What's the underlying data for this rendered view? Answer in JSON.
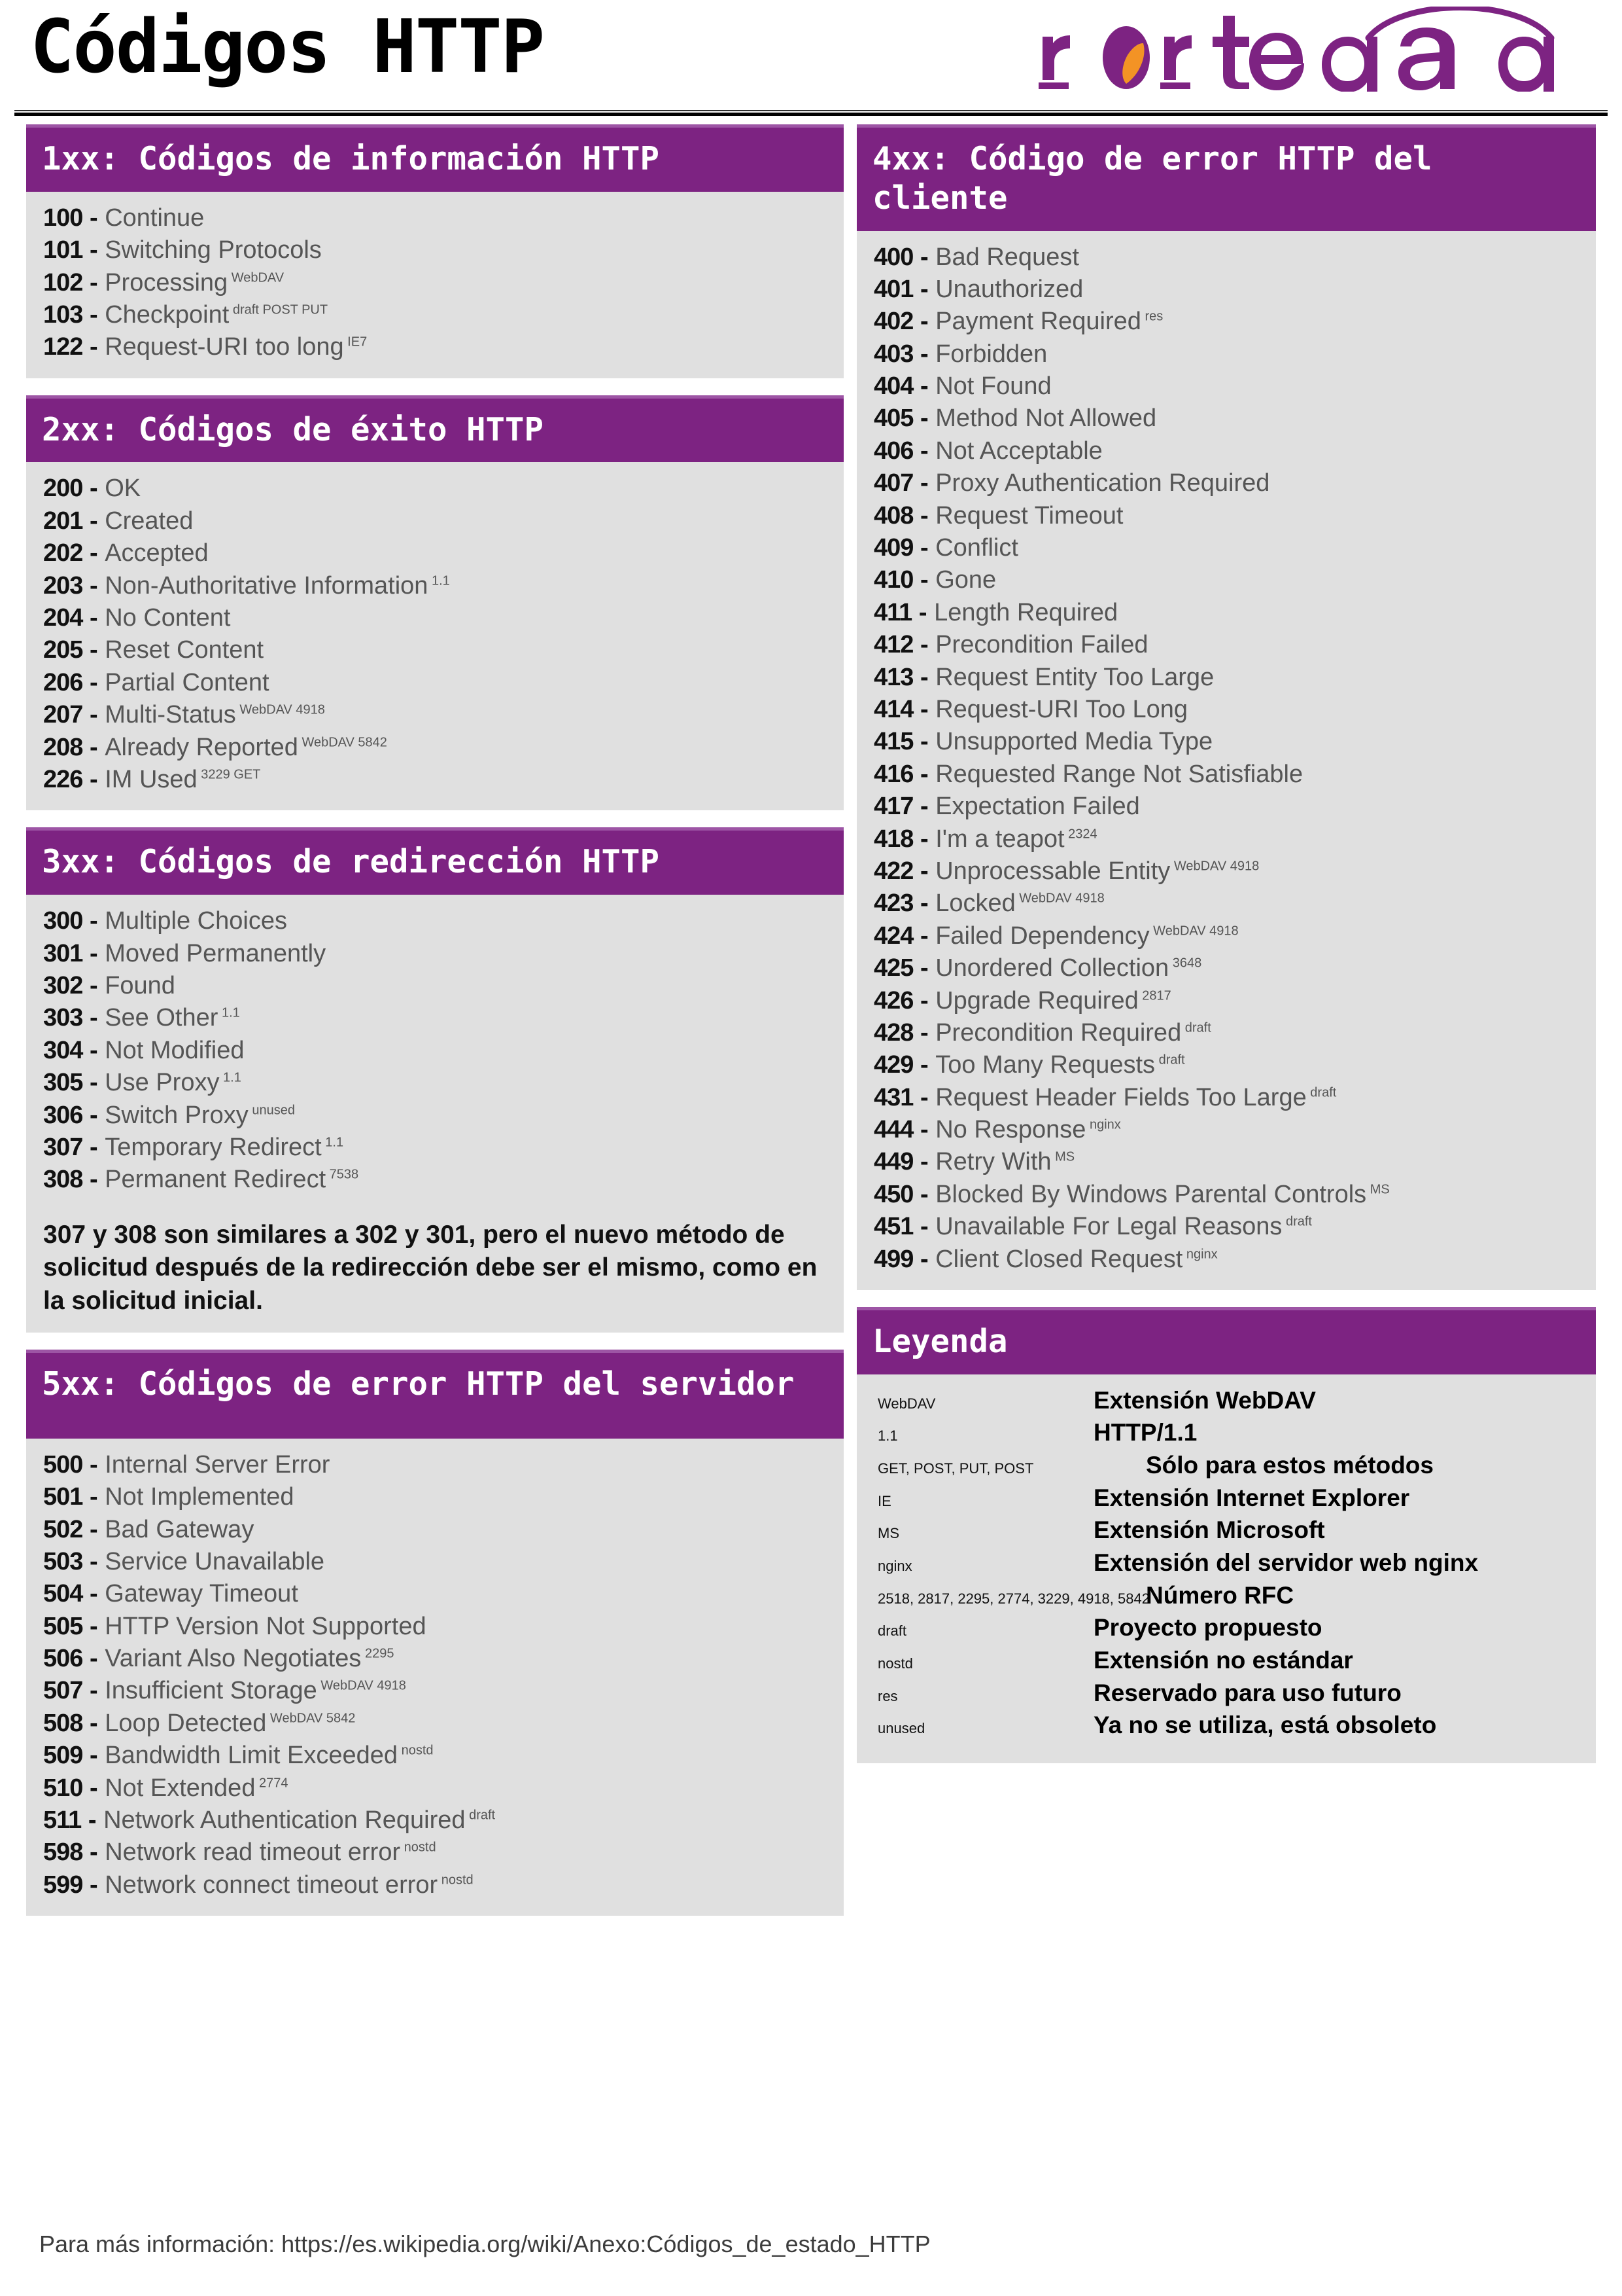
{
  "header": {
    "title": "Códigos HTTP",
    "brand": "rortegag",
    "brand_colors": {
      "purple": "#7D2382",
      "orange": "#F39325"
    }
  },
  "theme": {
    "header_purple": "#7D2382",
    "panel_gray": "#e0e0e0",
    "code_text": "#555555"
  },
  "panels": {
    "informational": {
      "heading": "1xx: Códigos de información HTTP",
      "codes": [
        {
          "num": "100",
          "text": "Continue",
          "sup": ""
        },
        {
          "num": "101",
          "text": "Switching Protocols",
          "sup": ""
        },
        {
          "num": "102",
          "text": "Processing",
          "sup": "WebDAV"
        },
        {
          "num": "103",
          "text": "Checkpoint",
          "sup": "draft POST PUT"
        },
        {
          "num": "122",
          "text": "Request-URI too long",
          "sup": "IE7"
        }
      ]
    },
    "success": {
      "heading": "2xx: Códigos de éxito HTTP",
      "codes": [
        {
          "num": "200",
          "text": "OK",
          "sup": ""
        },
        {
          "num": "201",
          "text": "Created",
          "sup": ""
        },
        {
          "num": "202",
          "text": "Accepted",
          "sup": ""
        },
        {
          "num": "203",
          "text": "Non-Authoritative Information",
          "sup": "1.1"
        },
        {
          "num": "204",
          "text": "No Content",
          "sup": ""
        },
        {
          "num": "205",
          "text": "Reset Content",
          "sup": ""
        },
        {
          "num": "206",
          "text": "Partial Content",
          "sup": ""
        },
        {
          "num": "207",
          "text": "Multi-Status",
          "sup": "WebDAV 4918"
        },
        {
          "num": "208",
          "text": "Already Reported",
          "sup": "WebDAV 5842"
        },
        {
          "num": "226",
          "text": "IM Used",
          "sup": "3229 GET"
        }
      ]
    },
    "redirection": {
      "heading": "3xx: Códigos de redirección HTTP",
      "codes": [
        {
          "num": "300",
          "text": "Multiple Choices",
          "sup": ""
        },
        {
          "num": "301",
          "text": "Moved Permanently",
          "sup": ""
        },
        {
          "num": "302",
          "text": "Found",
          "sup": ""
        },
        {
          "num": "303",
          "text": "See Other",
          "sup": "1.1"
        },
        {
          "num": "304",
          "text": "Not Modified",
          "sup": ""
        },
        {
          "num": "305",
          "text": "Use Proxy",
          "sup": "1.1"
        },
        {
          "num": "306",
          "text": "Switch Proxy",
          "sup": "unused"
        },
        {
          "num": "307",
          "text": "Temporary Redirect",
          "sup": "1.1"
        },
        {
          "num": "308",
          "text": "Permanent Redirect",
          "sup": "7538"
        }
      ],
      "note": "307 y 308 son similares a 302 y 301, pero el nuevo método de solicitud después de la redirección debe ser el mismo, como en la solicitud inicial."
    },
    "server_error": {
      "heading": "5xx: Códigos de error HTTP del servidor",
      "codes": [
        {
          "num": "500",
          "text": "Internal Server Error",
          "sup": ""
        },
        {
          "num": "501",
          "text": "Not Implemented",
          "sup": ""
        },
        {
          "num": "502",
          "text": "Bad Gateway",
          "sup": ""
        },
        {
          "num": "503",
          "text": "Service Unavailable",
          "sup": ""
        },
        {
          "num": "504",
          "text": "Gateway Timeout",
          "sup": ""
        },
        {
          "num": "505",
          "text": "HTTP Version Not Supported",
          "sup": ""
        },
        {
          "num": "506",
          "text": "Variant Also Negotiates",
          "sup": "2295"
        },
        {
          "num": "507",
          "text": "Insufficient Storage",
          "sup": "WebDAV 4918"
        },
        {
          "num": "508",
          "text": "Loop Detected",
          "sup": "WebDAV 5842"
        },
        {
          "num": "509",
          "text": "Bandwidth Limit Exceeded",
          "sup": "nostd"
        },
        {
          "num": "510",
          "text": "Not Extended",
          "sup": "2774"
        },
        {
          "num": "511",
          "text": "Network Authentication Required",
          "sup": "draft"
        },
        {
          "num": "598",
          "text": "Network read timeout error",
          "sup": "nostd"
        },
        {
          "num": "599",
          "text": "Network connect timeout error",
          "sup": "nostd"
        }
      ]
    },
    "client_error": {
      "heading": "4xx: Código de error HTTP del cliente",
      "codes": [
        {
          "num": "400",
          "text": "Bad Request",
          "sup": ""
        },
        {
          "num": "401",
          "text": "Unauthorized",
          "sup": ""
        },
        {
          "num": "402",
          "text": "Payment Required",
          "sup": "res"
        },
        {
          "num": "403",
          "text": "Forbidden",
          "sup": ""
        },
        {
          "num": "404",
          "text": "Not Found",
          "sup": ""
        },
        {
          "num": "405",
          "text": "Method Not Allowed",
          "sup": ""
        },
        {
          "num": "406",
          "text": "Not Acceptable",
          "sup": ""
        },
        {
          "num": "407",
          "text": "Proxy Authentication Required",
          "sup": ""
        },
        {
          "num": "408",
          "text": "Request Timeout",
          "sup": ""
        },
        {
          "num": "409",
          "text": "Conflict",
          "sup": ""
        },
        {
          "num": "410",
          "text": "Gone",
          "sup": ""
        },
        {
          "num": "411",
          "text": "Length Required",
          "sup": ""
        },
        {
          "num": "412",
          "text": "Precondition Failed",
          "sup": ""
        },
        {
          "num": "413",
          "text": "Request Entity Too Large",
          "sup": ""
        },
        {
          "num": "414",
          "text": "Request-URI Too Long",
          "sup": ""
        },
        {
          "num": "415",
          "text": "Unsupported Media Type",
          "sup": ""
        },
        {
          "num": "416",
          "text": "Requested Range Not Satisfiable",
          "sup": ""
        },
        {
          "num": "417",
          "text": "Expectation Failed",
          "sup": ""
        },
        {
          "num": "418",
          "text": "I'm a teapot",
          "sup": "2324"
        },
        {
          "num": "422",
          "text": "Unprocessable Entity",
          "sup": "WebDAV 4918"
        },
        {
          "num": "423",
          "text": "Locked",
          "sup": "WebDAV 4918"
        },
        {
          "num": "424",
          "text": "Failed Dependency",
          "sup": "WebDAV 4918"
        },
        {
          "num": "425",
          "text": "Unordered Collection",
          "sup": "3648"
        },
        {
          "num": "426",
          "text": "Upgrade Required",
          "sup": "2817"
        },
        {
          "num": "428",
          "text": "Precondition Required",
          "sup": "draft"
        },
        {
          "num": "429",
          "text": "Too Many Requests",
          "sup": "draft"
        },
        {
          "num": "431",
          "text": "Request Header Fields Too Large",
          "sup": "draft"
        },
        {
          "num": "444",
          "text": "No Response",
          "sup": "nginx"
        },
        {
          "num": "449",
          "text": "Retry With",
          "sup": "MS"
        },
        {
          "num": "450",
          "text": "Blocked By Windows Parental Controls",
          "sup": "MS"
        },
        {
          "num": "451",
          "text": "Unavailable For Legal Reasons",
          "sup": "draft"
        },
        {
          "num": "499",
          "text": "Client Closed Request",
          "sup": "nginx"
        }
      ]
    },
    "legend": {
      "heading": "Leyenda",
      "entries": [
        {
          "tag": "WebDAV",
          "desc": "Extensión WebDAV",
          "indent": false
        },
        {
          "tag": "1.1",
          "desc": "HTTP/1.1",
          "indent": false
        },
        {
          "tag": "GET, POST, PUT, POST",
          "desc": "Sólo para estos métodos",
          "indent": true
        },
        {
          "tag": "IE",
          "desc": "Extensión Internet Explorer",
          "indent": false
        },
        {
          "tag": "MS",
          "desc": "Extensión Microsoft",
          "indent": false
        },
        {
          "tag": "nginx",
          "desc": "Extensión del servidor web nginx",
          "indent": false
        },
        {
          "tag": "2518, 2817, 2295, 2774, 3229, 4918, 5842",
          "desc": "Número RFC",
          "indent": true
        },
        {
          "tag": "draft",
          "desc": "Proyecto propuesto",
          "indent": false
        },
        {
          "tag": "nostd",
          "desc": "Extensión no estándar",
          "indent": false
        },
        {
          "tag": "res",
          "desc": "Reservado para uso futuro",
          "indent": false
        },
        {
          "tag": "unused",
          "desc": "Ya no se utiliza, está obsoleto",
          "indent": false
        }
      ]
    }
  },
  "footer": {
    "text": "Para más información: https://es.wikipedia.org/wiki/Anexo:Códigos_de_estado_HTTP"
  }
}
